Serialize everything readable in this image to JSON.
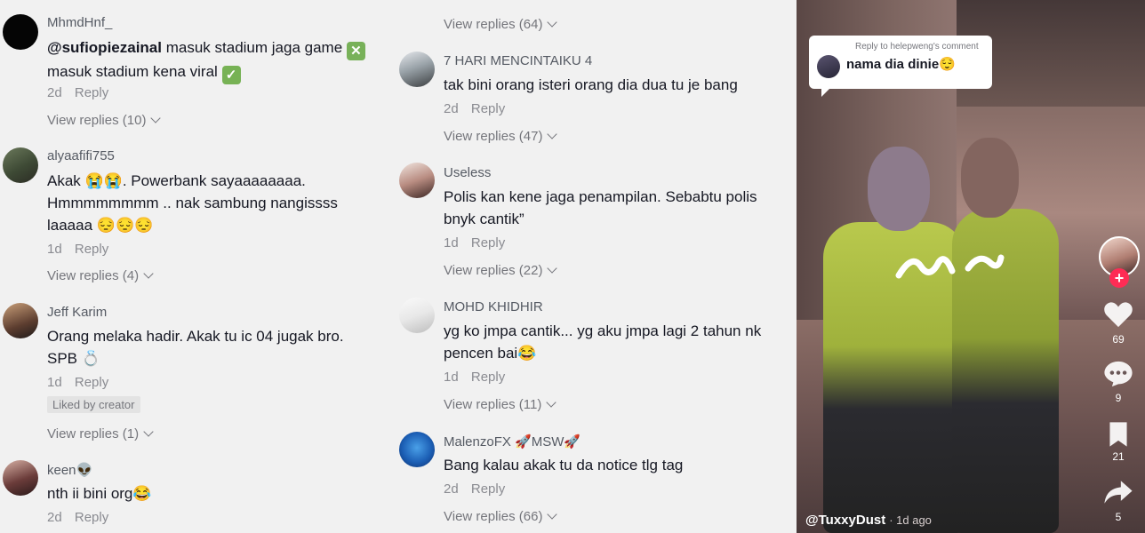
{
  "left": {
    "comments": [
      {
        "user": "MhmdHnf_",
        "mention": "@sufiopiezainal",
        "line1": "masuk stadium jaga game",
        "line2": "masuk stadium kena viral",
        "time": "2d",
        "reply": "Reply",
        "view_replies": "View replies (10)"
      },
      {
        "user": "alyaafifi755",
        "line1": "Akak 😭😭. Powerbank sayaaaaaaaa.",
        "line2": "Hmmmmmmmm .. nak sambung nangissss",
        "line3": "laaaaa 😔😔😔",
        "time": "1d",
        "reply": "Reply",
        "view_replies": "View replies (4)"
      },
      {
        "user": "Jeff Karim",
        "line1": "Orang melaka hadir. Akak tu ic 04 jugak bro.",
        "line2": "SPB 💍",
        "time": "1d",
        "reply": "Reply",
        "liked": "Liked by creator",
        "view_replies": "View replies (1)"
      },
      {
        "user": "keen👽",
        "line1": "nth ii bini org😂",
        "time": "2d",
        "reply": "Reply"
      }
    ]
  },
  "middle": {
    "top_view_replies": "View replies (64)",
    "comments": [
      {
        "user": "7 HARI MENCINTAIKU 4",
        "line1": "tak bini orang isteri orang dia dua tu je bang",
        "time": "2d",
        "reply": "Reply",
        "view_replies": "View replies (47)"
      },
      {
        "user": "Useless",
        "line1": "Polis kan kene jaga penampilan. Sebabtu polis",
        "line2": "bnyk cantik”",
        "time": "1d",
        "reply": "Reply",
        "view_replies": "View replies (22)"
      },
      {
        "user": "MOHD KHIDHIR",
        "line1": "yg ko jmpa cantik... yg aku jmpa lagi 2 tahun nk",
        "line2": "pencen bai😂",
        "time": "1d",
        "reply": "Reply",
        "view_replies": "View replies (11)"
      },
      {
        "user": "MalenzoFX 🚀MSW🚀",
        "line1": "Bang kalau akak tu da notice tlg tag",
        "time": "2d",
        "reply": "Reply",
        "view_replies": "View replies (66)"
      }
    ]
  },
  "video": {
    "reply_title": "Reply to helepweng's comment",
    "reply_message": "nama dia dinie😌",
    "likes": "69",
    "comments": "9",
    "saves": "21",
    "shares": "5",
    "handle": "@TuxxyDust",
    "ago": "· 1d ago"
  }
}
